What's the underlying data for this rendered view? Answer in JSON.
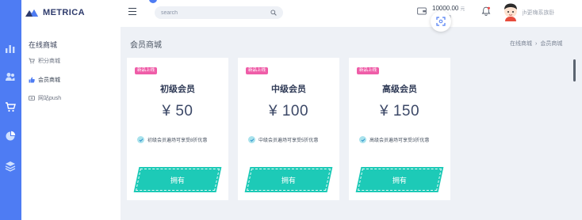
{
  "brand": {
    "name": "METRICA"
  },
  "sidebar": {
    "group_label": "在线商城",
    "items": [
      {
        "label": "积分商城",
        "icon": "cart-icon"
      },
      {
        "label": "会员商城",
        "icon": "thumbs-up-icon"
      },
      {
        "label": "网站push",
        "icon": "push-icon"
      }
    ]
  },
  "rail_icons": [
    "bar-chart-icon",
    "users-icon",
    "cart-icon",
    "pie-chart-icon",
    "layers-icon"
  ],
  "header": {
    "search_placeholder": "search",
    "balance_amount": "10000.00",
    "balance_unit": "元",
    "balance_label": "账户余额",
    "user_name": "jh更嗨系族卧"
  },
  "page": {
    "title": "会员商城",
    "breadcrumb": [
      "在线商城",
      "会员商城"
    ]
  },
  "cards": [
    {
      "badge": "新品上线",
      "name": "初级会员",
      "price": "¥ 50",
      "perk": "初级会员遍场可享受8折优惠",
      "button": "拥有"
    },
    {
      "badge": "新品上线",
      "name": "中级会员",
      "price": "¥ 100",
      "perk": "中级会员遍场可享受5折优惠",
      "button": "拥有"
    },
    {
      "badge": "新品上线",
      "name": "高级会员",
      "price": "¥ 150",
      "perk": "高级会员遍场可享受3折优惠",
      "button": "拥有"
    }
  ],
  "colors": {
    "rail": "#4e7cf3",
    "accent_button": "#1dcab7",
    "badge": "#ef5da8",
    "background": "#eef1f6"
  }
}
